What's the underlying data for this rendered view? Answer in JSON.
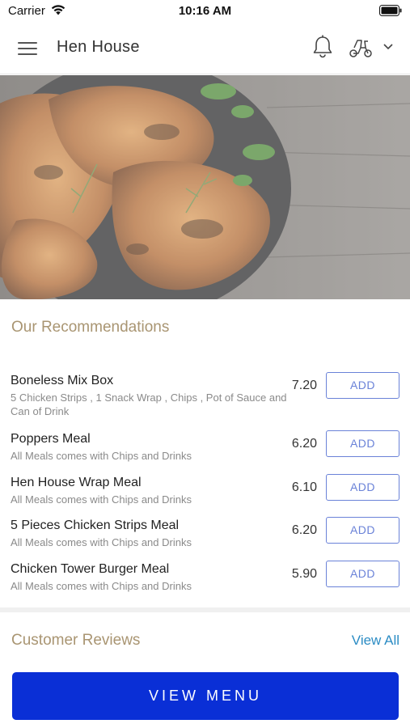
{
  "status_bar": {
    "carrier": "Carrier",
    "time": "10:16 AM"
  },
  "header": {
    "title": "Hen House",
    "icons": [
      "menu-icon",
      "bell-icon",
      "scooter-icon",
      "chevron-down-icon"
    ]
  },
  "hero": {
    "icon": "roast-chicken-photo"
  },
  "recommendations": {
    "title": "Our Recommendations",
    "items": [
      {
        "name": "Boneless Mix Box",
        "description": "5 Chicken Strips , 1 Snack Wrap , Chips , Pot of Sauce and Can of Drink",
        "price": "7.20",
        "button": "ADD"
      },
      {
        "name": "Poppers Meal",
        "description": "All Meals comes with Chips and Drinks",
        "price": "6.20",
        "button": "ADD"
      },
      {
        "name": "Hen House Wrap Meal",
        "description": "All Meals comes with Chips and Drinks",
        "price": "6.10",
        "button": "ADD"
      },
      {
        "name": "5 Pieces Chicken Strips Meal",
        "description": "All Meals comes with Chips and Drinks",
        "price": "6.20",
        "button": "ADD"
      },
      {
        "name": "Chicken Tower Burger Meal",
        "description": "All Meals comes with Chips and Drinks",
        "price": "5.90",
        "button": "ADD"
      }
    ]
  },
  "reviews": {
    "title": "Customer Reviews",
    "view_all": "View All"
  },
  "footer": {
    "view_menu": "VIEW MENU"
  },
  "colors": {
    "accent_gold": "#a99572",
    "button_blue": "#0a2fd6",
    "add_outline": "#6a82d8",
    "link_blue": "#2b8cc4"
  }
}
